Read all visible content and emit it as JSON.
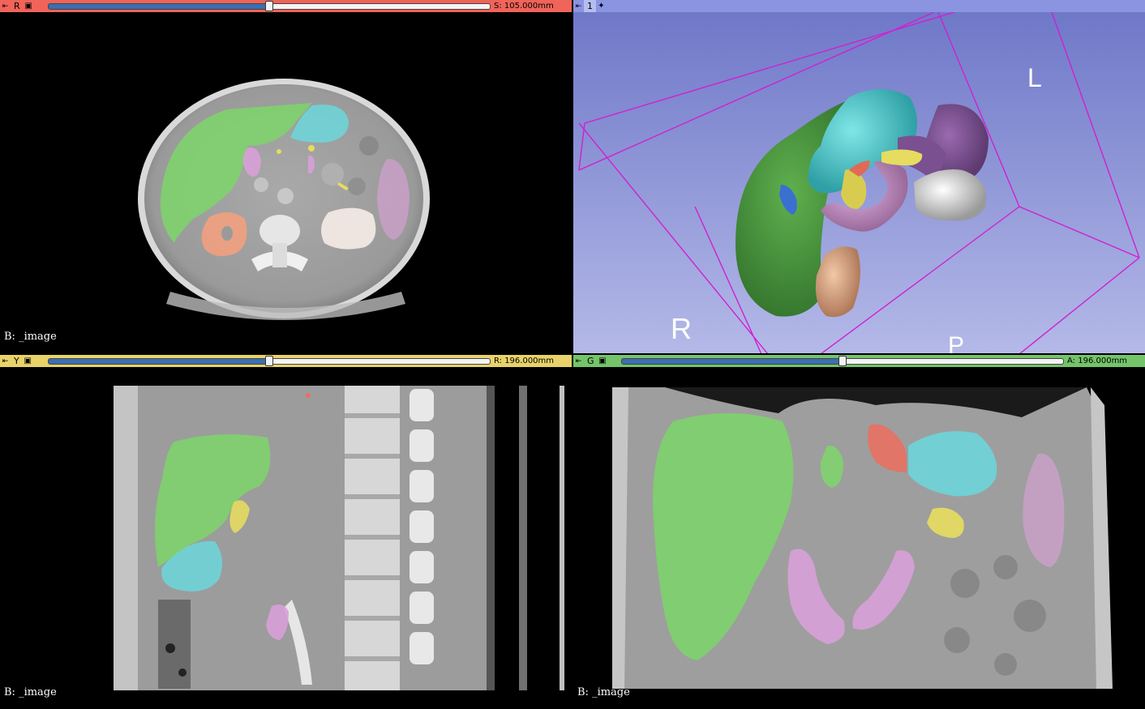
{
  "views": {
    "red": {
      "label": "R",
      "readout": "S: 105.000mm",
      "bar_color": "#f0645a",
      "slider_value": 0.5,
      "corner_text": "B: _image"
    },
    "threed": {
      "label": "1",
      "bar_color": "#8a94e0",
      "orientation": {
        "left": "L",
        "right": "R",
        "posterior": "P"
      }
    },
    "yellow": {
      "label": "Y",
      "readout": "R: 196.000mm",
      "bar_color": "#e8d36a",
      "slider_value": 0.5,
      "corner_text": "B: _image"
    },
    "green": {
      "label": "G",
      "readout": "A: 196.000mm",
      "bar_color": "#74c46a",
      "slider_value": 0.5,
      "corner_text": "B: _image"
    }
  },
  "icons": {
    "pin": "pin-icon",
    "link": "link-icon",
    "center": "center-view-icon"
  },
  "segment_colors": {
    "liver": "#7fd16e",
    "stomach": "#6fd4d8",
    "kidney_right": "#f0a080",
    "kidney_left": "#f2e8e4",
    "spleen": "#c9a0c8",
    "gallbladder": "#e6dc60",
    "aorta": "#e87060",
    "duodenum": "#d8a0d8"
  }
}
